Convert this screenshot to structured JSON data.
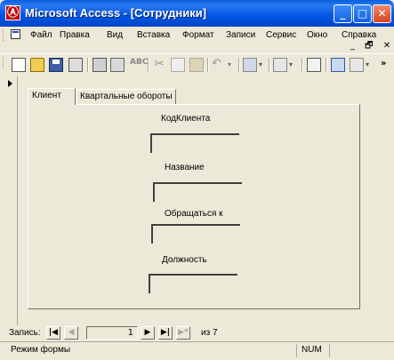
{
  "window": {
    "title": "Microsoft Access - [Сотрудники]",
    "minimize_glyph": "_",
    "maximize_glyph": "□",
    "close_glyph": "✕",
    "app_icon_letter": "Ⓐ"
  },
  "menu": {
    "items": [
      {
        "label": "Файл"
      },
      {
        "label": "Правка"
      },
      {
        "label": "Вид"
      },
      {
        "label": "Вставка"
      },
      {
        "label": "Формат"
      },
      {
        "label": "Записи"
      },
      {
        "label": "Сервис"
      },
      {
        "label": "Окно"
      },
      {
        "label": "Справка"
      }
    ],
    "mdi_controls": "_ 🗗 ✕"
  },
  "toolbar": {
    "icons": [
      "new-icon",
      "open-icon",
      "save-icon",
      "print-preview-icon",
      "print-icon",
      "print2-icon",
      "spelling-icon",
      "cut-icon",
      "copy-icon",
      "paste-icon",
      "undo-icon",
      "view-icon",
      "form-icon",
      "properties-icon",
      "relationships-icon",
      "new-object-icon"
    ],
    "spell_glyph": "ABC",
    "cut_glyph": "✂",
    "undo_glyph": "↶",
    "more_glyph": "»",
    "drop_glyph": "▾"
  },
  "tabs": {
    "active": "Клиент",
    "inactive": "Квартальные обороты"
  },
  "fields": [
    {
      "label": "КодКлиента",
      "value": ""
    },
    {
      "label": "Название",
      "value": ""
    },
    {
      "label": "Обращаться к",
      "value": ""
    },
    {
      "label": "Должность",
      "value": ""
    }
  ],
  "navigation": {
    "label": "Запись:",
    "first": "|◀",
    "prev": "◀",
    "next": "▶",
    "last": "▶|",
    "new": "▶*",
    "current": "1",
    "of_text": "из  7"
  },
  "status": {
    "mode": "Режим формы",
    "num": "NUM"
  },
  "colors": {
    "titlebar": "#0055e5",
    "face": "#ece9d8"
  }
}
